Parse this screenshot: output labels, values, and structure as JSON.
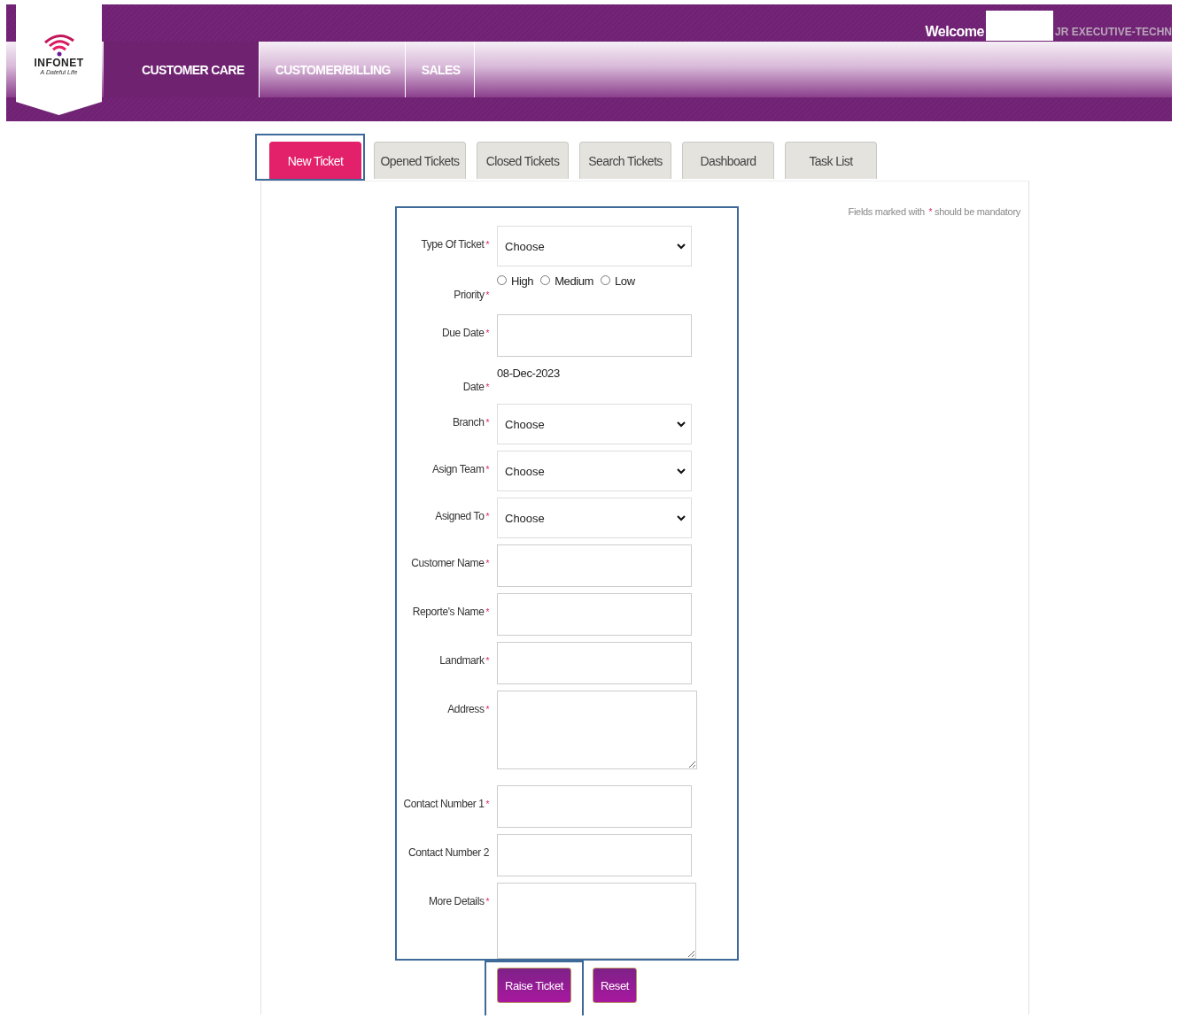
{
  "header": {
    "logo": {
      "name": "INFONET",
      "tagline": "A Dateful Life"
    },
    "welcome": "Welcome",
    "role": "JR EXECUTIVE-TECHN",
    "menu": [
      {
        "label": "CUSTOMER CARE",
        "selected": true
      },
      {
        "label": "CUSTOMER/BILLING",
        "selected": false
      },
      {
        "label": "SALES",
        "selected": false
      }
    ]
  },
  "tabs": [
    {
      "label": "New Ticket",
      "selected": true,
      "highlighted": true
    },
    {
      "label": "Opened Tickets",
      "selected": false,
      "highlighted": false
    },
    {
      "label": "Closed Tickets",
      "selected": false,
      "highlighted": false
    },
    {
      "label": "Search Tickets",
      "selected": false,
      "highlighted": false
    },
    {
      "label": "Dashboard",
      "selected": false,
      "highlighted": false
    },
    {
      "label": "Task List",
      "selected": false,
      "highlighted": false
    }
  ],
  "note": {
    "before": "Fields marked with",
    "mark": "*",
    "after": "should be mandatory"
  },
  "fields": [
    {
      "kind": "select",
      "label": "Type Of Ticket",
      "required": true,
      "value": "Choose"
    },
    {
      "kind": "radio",
      "label": "Priority",
      "required": true,
      "options": [
        {
          "label": "High",
          "selected": false
        },
        {
          "label": "Medium",
          "selected": false
        },
        {
          "label": "Low",
          "selected": false
        }
      ]
    },
    {
      "kind": "text",
      "label": "Due Date",
      "required": true
    },
    {
      "kind": "static",
      "label": "Date",
      "required": true,
      "value": "08-Dec-2023"
    },
    {
      "kind": "select",
      "label": "Branch",
      "required": true,
      "value": "Choose"
    },
    {
      "kind": "select",
      "label": "Asign Team",
      "required": true,
      "value": "Choose"
    },
    {
      "kind": "select",
      "label": "Asigned To",
      "required": true,
      "value": "Choose"
    },
    {
      "kind": "text",
      "label": "Customer Name",
      "required": true
    },
    {
      "kind": "text",
      "label": "Reporte's Name",
      "required": true
    },
    {
      "kind": "text",
      "label": "Landmark",
      "required": true
    },
    {
      "kind": "textarea",
      "label": "Address",
      "required": true
    },
    {
      "kind": "text",
      "label": "Contact Number 1",
      "required": true
    },
    {
      "kind": "text",
      "label": "Contact Number 2",
      "required": false
    },
    {
      "kind": "textarea",
      "label": "More Details",
      "required": true
    }
  ],
  "buttons": [
    {
      "label": "Raise Ticket",
      "highlighted": true
    },
    {
      "label": "Reset",
      "highlighted": false
    }
  ]
}
